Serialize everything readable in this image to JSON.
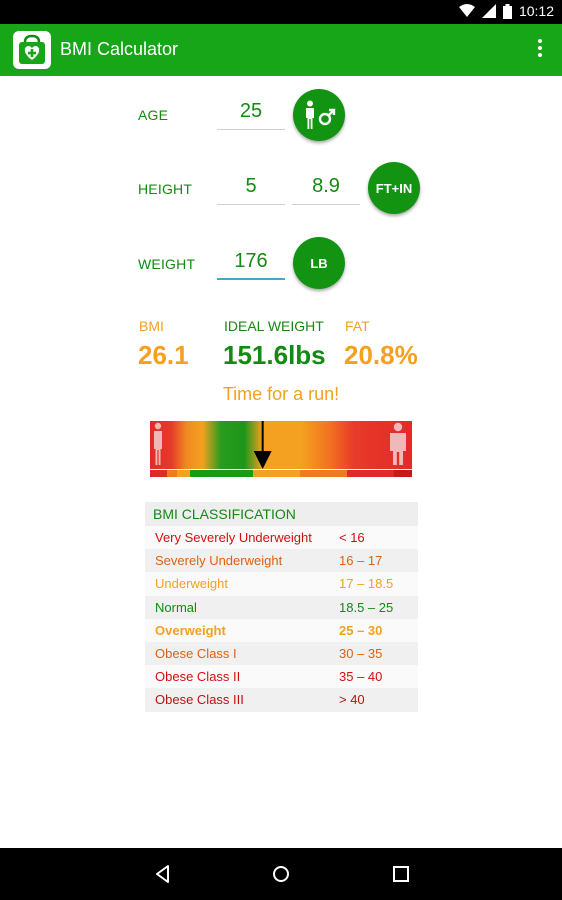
{
  "status_bar": {
    "time": "10:12",
    "icons": [
      "wifi-icon",
      "signal-icon",
      "battery-icon"
    ]
  },
  "app_bar": {
    "title": "BMI Calculator",
    "icon": "medical-bag-icon",
    "menu_icon": "overflow-menu-icon",
    "color": "#17a617"
  },
  "inputs": {
    "age": {
      "label": "AGE",
      "value": "25",
      "button_icon": "male-gender-icon"
    },
    "height": {
      "label": "HEIGHT",
      "feet": "5",
      "inches": "8.9",
      "unit_button": "FT+IN"
    },
    "weight": {
      "label": "WEIGHT",
      "value": "176",
      "unit_button": "LB"
    }
  },
  "results": {
    "bmi": {
      "label": "BMI",
      "value": "26.1"
    },
    "ideal_weight": {
      "label": "IDEAL WEIGHT",
      "value": "151.6lbs"
    },
    "fat": {
      "label": "FAT",
      "value": "20.8%"
    }
  },
  "message": "Time for a run!",
  "scale": {
    "indicator_position_fraction": 0.43,
    "colors": {
      "red": "#e23030",
      "orange": "#f07a20",
      "yellow": "#f4a020",
      "green": "#1a9a1a"
    }
  },
  "classification": {
    "title": "BMI CLASSIFICATION",
    "rows": [
      {
        "name": "Very Severely Underweight",
        "range": "< 16",
        "color": "#d01010",
        "bold": false
      },
      {
        "name": "Severely Underweight",
        "range": "16 – 17",
        "color": "#e06010",
        "bold": false
      },
      {
        "name": "Underweight",
        "range": "17 – 18.5",
        "color": "#f4a020",
        "bold": false
      },
      {
        "name": "Normal",
        "range": "18.5 – 25",
        "color": "#138a13",
        "bold": false
      },
      {
        "name": "Overweight",
        "range": "25 – 30",
        "color": "#f4a020",
        "bold": true
      },
      {
        "name": "Obese Class I",
        "range": "30 – 35",
        "color": "#e06010",
        "bold": false
      },
      {
        "name": "Obese Class II",
        "range": "35 – 40",
        "color": "#d01010",
        "bold": false
      },
      {
        "name": "Obese Class III",
        "range": "> 40",
        "color": "#c01010",
        "bold": false
      }
    ]
  },
  "nav_bar": {
    "buttons": [
      "back-icon",
      "home-icon",
      "recents-icon"
    ]
  }
}
